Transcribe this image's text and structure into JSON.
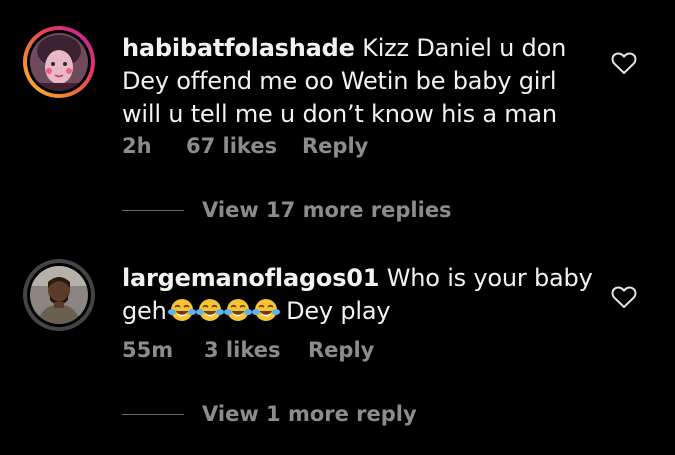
{
  "comments": [
    {
      "username": "habibatfolashade",
      "text": "Kizz Daniel u don Dey offend me oo Wetin be baby girl will u tell me u don’t know his a man",
      "time": "2h",
      "likes": "67 likes",
      "reply_label": "Reply",
      "view_replies": "View 17 more replies",
      "avatar_icon": "user-avatar-girl-filter"
    },
    {
      "username": "largemanoflagos01",
      "text_before": "Who is your baby geh",
      "emojis": [
        "😂",
        "😂",
        "😂",
        "😂"
      ],
      "text_after": "Dey play",
      "time": "55m",
      "likes": "3 likes",
      "reply_label": "Reply",
      "view_replies": "View 1 more reply",
      "avatar_icon": "user-avatar-man"
    }
  ],
  "colors": {
    "background": "#000000",
    "text": "#f2f2f2",
    "meta": "#8c8c8c",
    "story_ring_start": "#f9c33c",
    "story_ring_end": "#b02ab0"
  }
}
